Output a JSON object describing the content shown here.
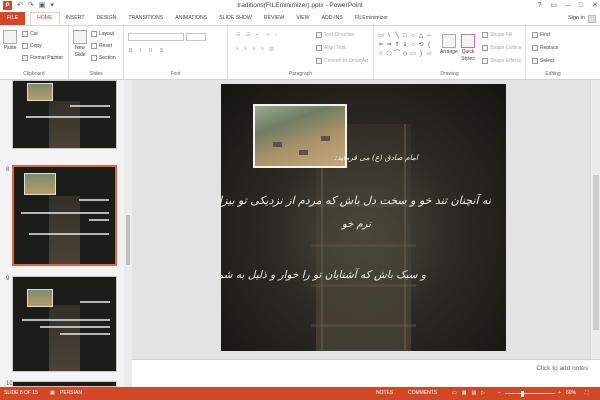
{
  "window": {
    "title": "traditions(FILEminimizer).pptx - PowerPoint",
    "app_logo": "P",
    "controls": [
      "?",
      "▭",
      "–",
      "□",
      "✕"
    ]
  },
  "qat": [
    "↶",
    "↷",
    "▣",
    "▾"
  ],
  "ribbon_tabs": [
    {
      "label": "HOME",
      "active": true
    },
    {
      "label": "INSERT"
    },
    {
      "label": "DESIGN"
    },
    {
      "label": "TRANSITIONS"
    },
    {
      "label": "ANIMATIONS"
    },
    {
      "label": "SLIDE SHOW"
    },
    {
      "label": "REVIEW"
    },
    {
      "label": "VIEW"
    },
    {
      "label": "ADD-INS"
    },
    {
      "label": "FILEminimizer"
    }
  ],
  "file_tab": "FILE",
  "signin": "Sign in",
  "ribbon": {
    "clipboard": {
      "label": "Clipboard",
      "paste": "Paste",
      "cut": "Cut",
      "copy": "Copy",
      "format_painter": "Format Painter"
    },
    "slides": {
      "label": "Slides",
      "new_slide_1": "New",
      "new_slide_2": "Slide",
      "layout": "Layout",
      "reset": "Reset",
      "section": "Section"
    },
    "font": {
      "label": "Font"
    },
    "paragraph": {
      "label": "Paragraph",
      "text_direction": "Text Direction",
      "align_text": "Align Text",
      "convert_smartart": "Convert to SmartArt"
    },
    "drawing": {
      "label": "Drawing",
      "arrange": "Arrange",
      "quick_styles_1": "Quick",
      "quick_styles_2": "Styles",
      "shape_fill": "Shape Fill",
      "shape_outline": "Shape Outline",
      "shape_effects": "Shape Effects"
    },
    "editing": {
      "label": "Editing",
      "find": "Find",
      "replace": "Replace",
      "select": "Select"
    },
    "shape_glyphs": [
      "▭",
      "\\",
      "╲",
      "□",
      "○",
      "△",
      "⌐",
      "⇐",
      "⇒",
      "⇑",
      "⇓",
      "○",
      "⟲",
      "{",
      "☆",
      "⬡",
      "⌒",
      "◇",
      "▭",
      "}",
      "▱"
    ]
  },
  "slide_numbers": {
    "current": "8",
    "next": "9",
    "last_partial": "10"
  },
  "slide": {
    "line1": "امام صادق (ع) می فرماید:",
    "line2": "نه آنچنان تند خو و سخت دل باش که مردم از نزدیکی تو بیزار باشند و نه آنچنان",
    "line3": "نرم خو",
    "line4": "و سبک باش که آشنایان تو را خوار و ذلیل به شمار آورند."
  },
  "notes_placeholder": "Click to add notes",
  "statusbar": {
    "slide_info": "SLIDE 8 OF 15",
    "language": "PERSIAN",
    "notes": "NOTES",
    "comments": "COMMENTS",
    "zoom": "60%",
    "zoom_level": 60
  },
  "colors": {
    "accent": "#d24726"
  }
}
